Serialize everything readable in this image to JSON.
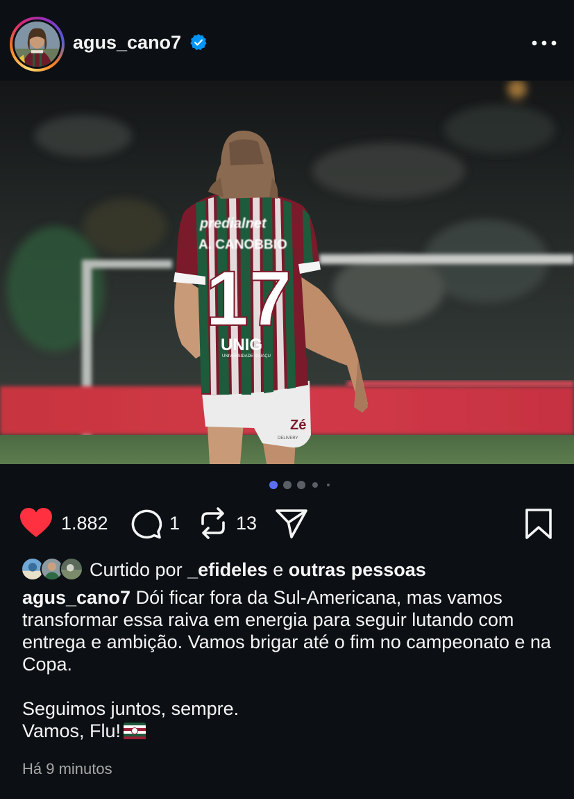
{
  "post": {
    "username": "agus_cano7",
    "verified": true,
    "likes_count": "1.882",
    "comments_count": "1",
    "reposts_count": "13",
    "liked_by_prefix": "Curtido por",
    "liked_by_user": "_efideles",
    "liked_by_conjunction": "e",
    "liked_by_others": "outras pessoas",
    "caption_username": "agus_cano7",
    "caption_para1": "Dói ficar fora da Sul-Americana, mas vamos transformar essa raiva em energia para seguir lutando com entrega e ambição. Vamos brigar até o fim no campeonato e na Copa.",
    "caption_line2": "Seguimos juntos, sempre.",
    "caption_line3": "Vamos, Flu!",
    "timestamp": "Há 9 minutos"
  },
  "media": {
    "jersey_name": "A. CANOBBIO",
    "jersey_number": "17",
    "jersey_sponsor_top": "predialnet",
    "jersey_sponsor_bottom": "UNIG",
    "jersey_sponsor_bottom_sub": "UNIVERSIDADE IGUAÇU",
    "shorts_sponsor": "Zé",
    "shorts_sponsor_sub": "DELIVERY"
  },
  "carousel": {
    "total": 5,
    "active_index": 0
  },
  "icons": {
    "verified": "verified-badge-icon",
    "more": "more-options-icon",
    "like": "heart-icon",
    "comment": "comment-icon",
    "repost": "repost-icon",
    "share": "share-icon",
    "save": "bookmark-icon",
    "flag": "fluminense-flag-icon"
  },
  "colors": {
    "background": "#0c1014",
    "text": "#f5f5f5",
    "muted": "#a8a8a8",
    "like": "#ff3040",
    "verified": "#0095f6",
    "dot_active": "#5b6ff5",
    "dot_inactive": "#5a5f66",
    "jersey_maroon": "#7b1a2a",
    "jersey_green": "#1e5a3c"
  }
}
